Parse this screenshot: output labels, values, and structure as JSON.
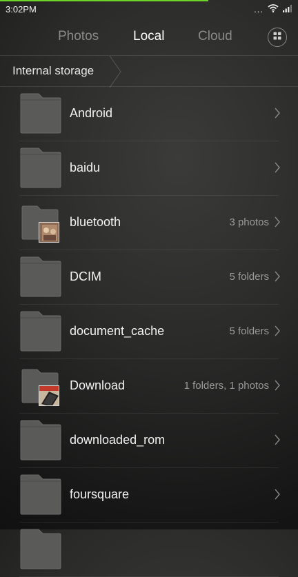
{
  "status_bar": {
    "time": "3:02PM",
    "dots": "..."
  },
  "tabs": [
    {
      "label": "Photos",
      "active": false
    },
    {
      "label": "Local",
      "active": true
    },
    {
      "label": "Cloud",
      "active": false
    }
  ],
  "breadcrumb": {
    "label": "Internal storage"
  },
  "folders": [
    {
      "name": "Android",
      "meta": ""
    },
    {
      "name": "baidu",
      "meta": ""
    },
    {
      "name": "bluetooth",
      "meta": "3 photos"
    },
    {
      "name": "DCIM",
      "meta": "5 folders"
    },
    {
      "name": "document_cache",
      "meta": "5 folders"
    },
    {
      "name": "Download",
      "meta": "1 folders, 1 photos"
    },
    {
      "name": "downloaded_rom",
      "meta": ""
    },
    {
      "name": "foursquare",
      "meta": ""
    }
  ],
  "icons": {
    "grid": "grid-view-icon",
    "folder": "folder-icon",
    "chevron": "chevron-right-icon",
    "wifi": "wifi-icon",
    "signal": "signal-icon"
  }
}
